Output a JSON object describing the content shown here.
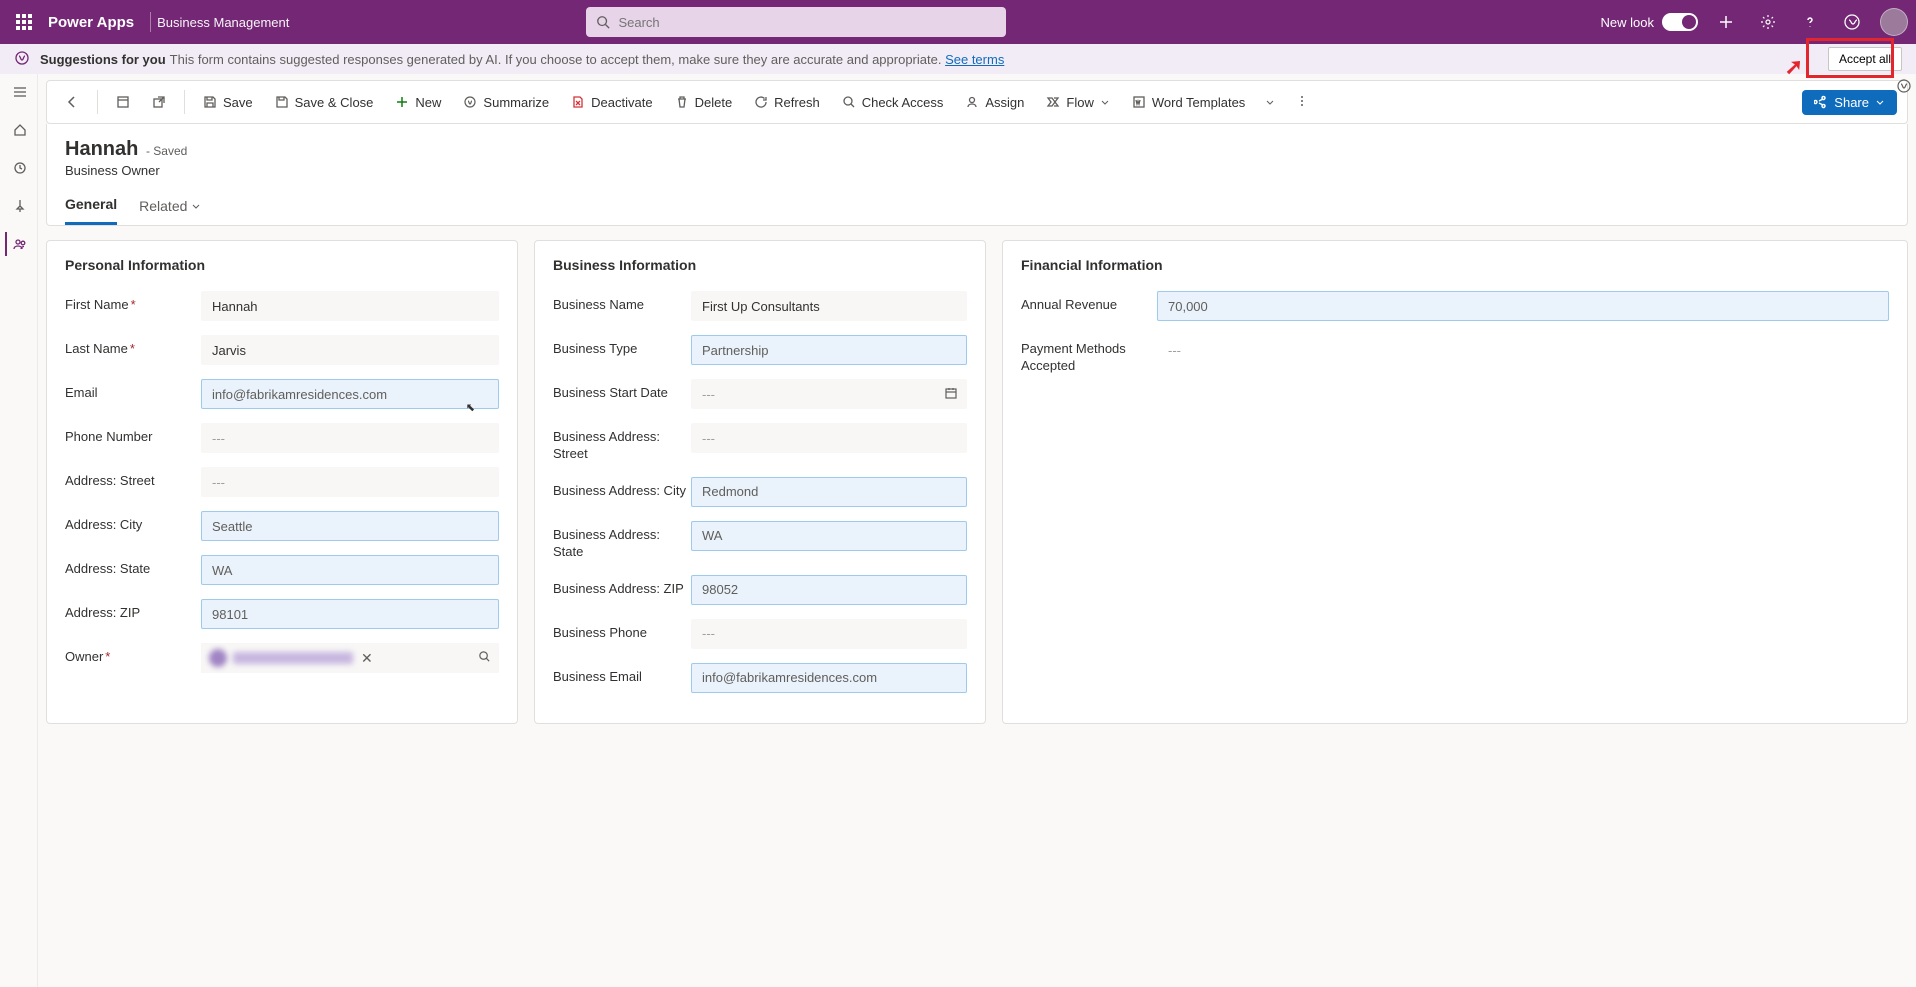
{
  "topbar": {
    "app": "Power Apps",
    "env": "Business Management",
    "search_placeholder": "Search",
    "new_look": "New look"
  },
  "suggestions": {
    "label": "Suggestions for you",
    "text": "This form contains suggested responses generated by AI. If you choose to accept them, make sure they are accurate and appropriate.",
    "link": "See terms",
    "accept": "Accept all"
  },
  "commands": {
    "save": "Save",
    "save_close": "Save & Close",
    "new": "New",
    "summarize": "Summarize",
    "deactivate": "Deactivate",
    "delete": "Delete",
    "refresh": "Refresh",
    "check_access": "Check Access",
    "assign": "Assign",
    "flow": "Flow",
    "word_templates": "Word Templates",
    "share": "Share"
  },
  "record": {
    "title": "Hannah",
    "status": "- Saved",
    "subtitle": "Business Owner",
    "tabs": {
      "general": "General",
      "related": "Related"
    }
  },
  "sections": {
    "personal": {
      "title": "Personal Information",
      "first_name": {
        "label": "First Name",
        "value": "Hannah"
      },
      "last_name": {
        "label": "Last Name",
        "value": "Jarvis"
      },
      "email": {
        "label": "Email",
        "value": "info@fabrikamresidences.com"
      },
      "phone": {
        "label": "Phone Number",
        "value": "---"
      },
      "street": {
        "label": "Address: Street",
        "value": "---"
      },
      "city": {
        "label": "Address: City",
        "value": "Seattle"
      },
      "state": {
        "label": "Address: State",
        "value": "WA"
      },
      "zip": {
        "label": "Address: ZIP",
        "value": "98101"
      },
      "owner": {
        "label": "Owner",
        "value": ""
      }
    },
    "business": {
      "title": "Business Information",
      "name": {
        "label": "Business Name",
        "value": "First Up Consultants"
      },
      "type": {
        "label": "Business Type",
        "value": "Partnership"
      },
      "start": {
        "label": "Business Start Date",
        "value": "---"
      },
      "street": {
        "label": "Business Address: Street",
        "value": "---"
      },
      "city": {
        "label": "Business Address: City",
        "value": "Redmond"
      },
      "state": {
        "label": "Business Address: State",
        "value": "WA"
      },
      "zip": {
        "label": "Business Address: ZIP",
        "value": "98052"
      },
      "phone": {
        "label": "Business Phone",
        "value": "---"
      },
      "email": {
        "label": "Business Email",
        "value": "info@fabrikamresidences.com"
      }
    },
    "financial": {
      "title": "Financial Information",
      "revenue": {
        "label": "Annual Revenue",
        "value": "70,000"
      },
      "payment": {
        "label": "Payment Methods Accepted",
        "value": "---"
      }
    }
  }
}
